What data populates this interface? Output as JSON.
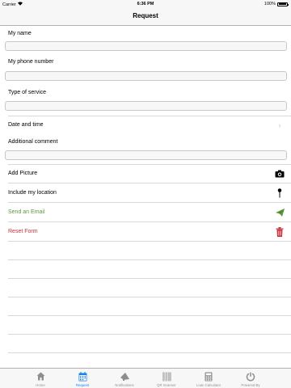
{
  "status_bar": {
    "carrier": "Carrier",
    "time": "6:36 PM",
    "battery": "100%",
    "battery_level": 1.0
  },
  "nav": {
    "title": "Request"
  },
  "form": {
    "name_label": "My name",
    "phone_label": "My phone number",
    "service_label": "Type of service",
    "datetime_label": "Date and time",
    "comment_label": "Additional comment",
    "add_picture_label": "Add Picture",
    "location_label": "Include my location",
    "email_label": "Send an Email",
    "reset_label": "Reset Form"
  },
  "icons": {
    "camera": "camera-icon",
    "location": "location-pin-icon",
    "send": "paper-plane-icon",
    "trash": "trash-icon",
    "chevron": "chevron-right-icon"
  },
  "colors": {
    "accent": "#1a82e2",
    "send": "#5a9a3a",
    "reset": "#c8323a"
  },
  "tabs": [
    {
      "label": "Home",
      "icon": "home-icon"
    },
    {
      "label": "Request",
      "icon": "calendar-icon",
      "active": true
    },
    {
      "label": "Notifications",
      "icon": "megaphone-icon"
    },
    {
      "label": "QR Scanner",
      "icon": "barcode-icon"
    },
    {
      "label": "Loan Calculator",
      "icon": "calculator-icon"
    },
    {
      "label": "Powered By",
      "icon": "power-icon"
    }
  ]
}
